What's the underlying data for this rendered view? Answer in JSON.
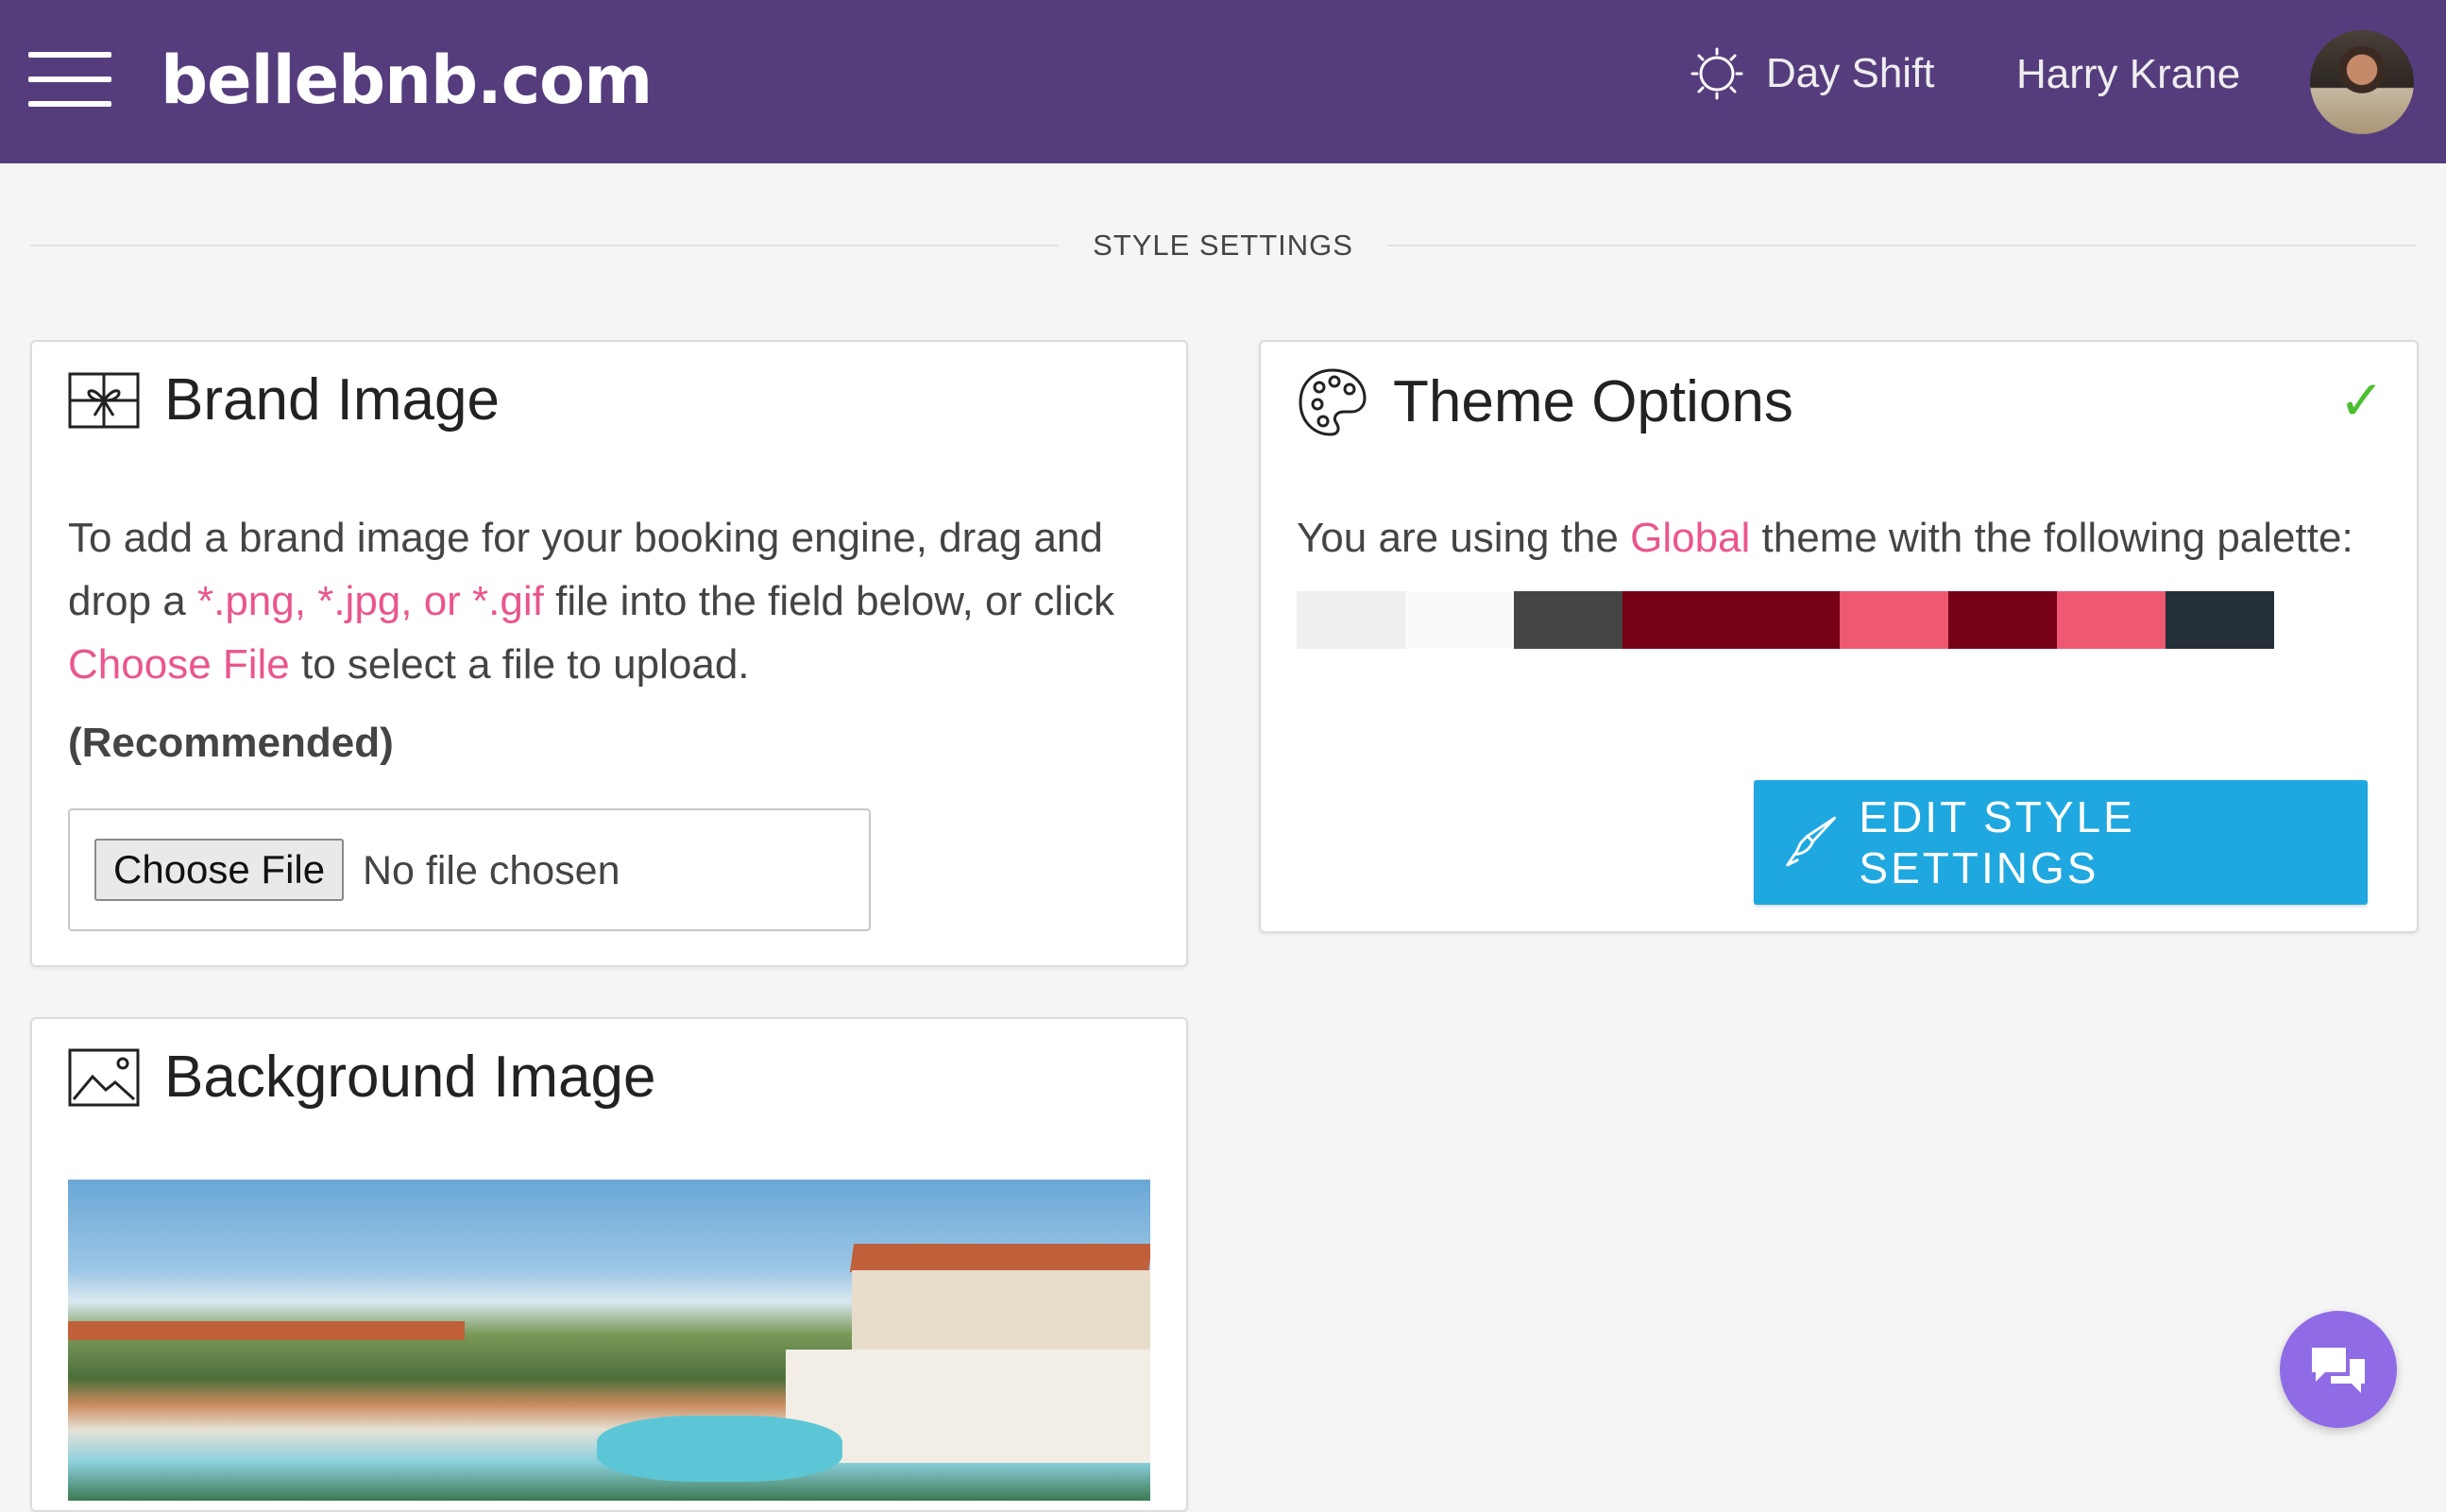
{
  "header": {
    "brand": "bellebnb.com",
    "shift_label": "Day Shift",
    "user_name": "Harry Krane",
    "background": "#553d7d"
  },
  "section": {
    "title": "STYLE SETTINGS"
  },
  "brand_image": {
    "title": "Brand Image",
    "intro_before": "To add a brand image for your booking engine, drag and drop a ",
    "file_types": "*.png, *.jpg, or *.gif",
    "intro_middle": " file into the field below, or click ",
    "choose_link": "Choose File",
    "intro_after": " to select a file to upload.",
    "recommended": "(Recommended)",
    "file_input": {
      "button_label": "Choose File",
      "status": "No file chosen"
    }
  },
  "theme_options": {
    "title": "Theme Options",
    "status_icon": "check-icon",
    "text_before": "You are using the ",
    "theme_name": "Global",
    "text_after": " theme with the following palette:",
    "palette": [
      "#eeeeee",
      "#f9f9f9",
      "#454545",
      "#760016",
      "#760016",
      "#ee5870",
      "#760016",
      "#ee5870",
      "#252f3a"
    ],
    "edit_button": "EDIT STYLE SETTINGS",
    "accent": "#1fa8df"
  },
  "background_image": {
    "title": "Background Image"
  },
  "icons": {
    "menu": "hamburger-icon",
    "shift": "sun-icon",
    "brand_image": "gift-icon",
    "theme": "palette-icon",
    "background": "image-icon",
    "edit": "paintbrush-icon",
    "chat": "chat-icon"
  }
}
